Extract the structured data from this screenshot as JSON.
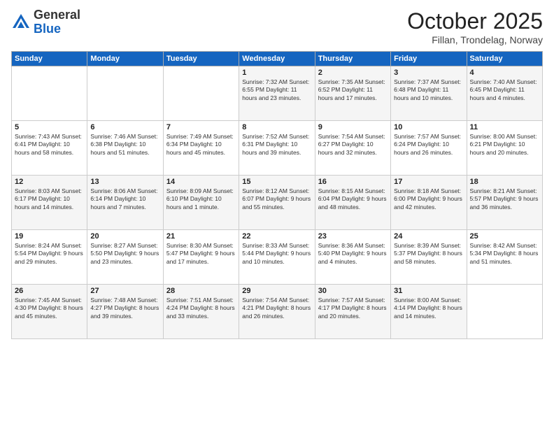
{
  "header": {
    "logo_general": "General",
    "logo_blue": "Blue",
    "month_title": "October 2025",
    "location": "Fillan, Trondelag, Norway"
  },
  "days_of_week": [
    "Sunday",
    "Monday",
    "Tuesday",
    "Wednesday",
    "Thursday",
    "Friday",
    "Saturday"
  ],
  "weeks": [
    [
      {
        "day": "",
        "info": ""
      },
      {
        "day": "",
        "info": ""
      },
      {
        "day": "",
        "info": ""
      },
      {
        "day": "1",
        "info": "Sunrise: 7:32 AM\nSunset: 6:55 PM\nDaylight: 11 hours\nand 23 minutes."
      },
      {
        "day": "2",
        "info": "Sunrise: 7:35 AM\nSunset: 6:52 PM\nDaylight: 11 hours\nand 17 minutes."
      },
      {
        "day": "3",
        "info": "Sunrise: 7:37 AM\nSunset: 6:48 PM\nDaylight: 11 hours\nand 10 minutes."
      },
      {
        "day": "4",
        "info": "Sunrise: 7:40 AM\nSunset: 6:45 PM\nDaylight: 11 hours\nand 4 minutes."
      }
    ],
    [
      {
        "day": "5",
        "info": "Sunrise: 7:43 AM\nSunset: 6:41 PM\nDaylight: 10 hours\nand 58 minutes."
      },
      {
        "day": "6",
        "info": "Sunrise: 7:46 AM\nSunset: 6:38 PM\nDaylight: 10 hours\nand 51 minutes."
      },
      {
        "day": "7",
        "info": "Sunrise: 7:49 AM\nSunset: 6:34 PM\nDaylight: 10 hours\nand 45 minutes."
      },
      {
        "day": "8",
        "info": "Sunrise: 7:52 AM\nSunset: 6:31 PM\nDaylight: 10 hours\nand 39 minutes."
      },
      {
        "day": "9",
        "info": "Sunrise: 7:54 AM\nSunset: 6:27 PM\nDaylight: 10 hours\nand 32 minutes."
      },
      {
        "day": "10",
        "info": "Sunrise: 7:57 AM\nSunset: 6:24 PM\nDaylight: 10 hours\nand 26 minutes."
      },
      {
        "day": "11",
        "info": "Sunrise: 8:00 AM\nSunset: 6:21 PM\nDaylight: 10 hours\nand 20 minutes."
      }
    ],
    [
      {
        "day": "12",
        "info": "Sunrise: 8:03 AM\nSunset: 6:17 PM\nDaylight: 10 hours\nand 14 minutes."
      },
      {
        "day": "13",
        "info": "Sunrise: 8:06 AM\nSunset: 6:14 PM\nDaylight: 10 hours\nand 7 minutes."
      },
      {
        "day": "14",
        "info": "Sunrise: 8:09 AM\nSunset: 6:10 PM\nDaylight: 10 hours\nand 1 minute."
      },
      {
        "day": "15",
        "info": "Sunrise: 8:12 AM\nSunset: 6:07 PM\nDaylight: 9 hours\nand 55 minutes."
      },
      {
        "day": "16",
        "info": "Sunrise: 8:15 AM\nSunset: 6:04 PM\nDaylight: 9 hours\nand 48 minutes."
      },
      {
        "day": "17",
        "info": "Sunrise: 8:18 AM\nSunset: 6:00 PM\nDaylight: 9 hours\nand 42 minutes."
      },
      {
        "day": "18",
        "info": "Sunrise: 8:21 AM\nSunset: 5:57 PM\nDaylight: 9 hours\nand 36 minutes."
      }
    ],
    [
      {
        "day": "19",
        "info": "Sunrise: 8:24 AM\nSunset: 5:54 PM\nDaylight: 9 hours\nand 29 minutes."
      },
      {
        "day": "20",
        "info": "Sunrise: 8:27 AM\nSunset: 5:50 PM\nDaylight: 9 hours\nand 23 minutes."
      },
      {
        "day": "21",
        "info": "Sunrise: 8:30 AM\nSunset: 5:47 PM\nDaylight: 9 hours\nand 17 minutes."
      },
      {
        "day": "22",
        "info": "Sunrise: 8:33 AM\nSunset: 5:44 PM\nDaylight: 9 hours\nand 10 minutes."
      },
      {
        "day": "23",
        "info": "Sunrise: 8:36 AM\nSunset: 5:40 PM\nDaylight: 9 hours\nand 4 minutes."
      },
      {
        "day": "24",
        "info": "Sunrise: 8:39 AM\nSunset: 5:37 PM\nDaylight: 8 hours\nand 58 minutes."
      },
      {
        "day": "25",
        "info": "Sunrise: 8:42 AM\nSunset: 5:34 PM\nDaylight: 8 hours\nand 51 minutes."
      }
    ],
    [
      {
        "day": "26",
        "info": "Sunrise: 7:45 AM\nSunset: 4:30 PM\nDaylight: 8 hours\nand 45 minutes."
      },
      {
        "day": "27",
        "info": "Sunrise: 7:48 AM\nSunset: 4:27 PM\nDaylight: 8 hours\nand 39 minutes."
      },
      {
        "day": "28",
        "info": "Sunrise: 7:51 AM\nSunset: 4:24 PM\nDaylight: 8 hours\nand 33 minutes."
      },
      {
        "day": "29",
        "info": "Sunrise: 7:54 AM\nSunset: 4:21 PM\nDaylight: 8 hours\nand 26 minutes."
      },
      {
        "day": "30",
        "info": "Sunrise: 7:57 AM\nSunset: 4:17 PM\nDaylight: 8 hours\nand 20 minutes."
      },
      {
        "day": "31",
        "info": "Sunrise: 8:00 AM\nSunset: 4:14 PM\nDaylight: 8 hours\nand 14 minutes."
      },
      {
        "day": "",
        "info": ""
      }
    ]
  ]
}
